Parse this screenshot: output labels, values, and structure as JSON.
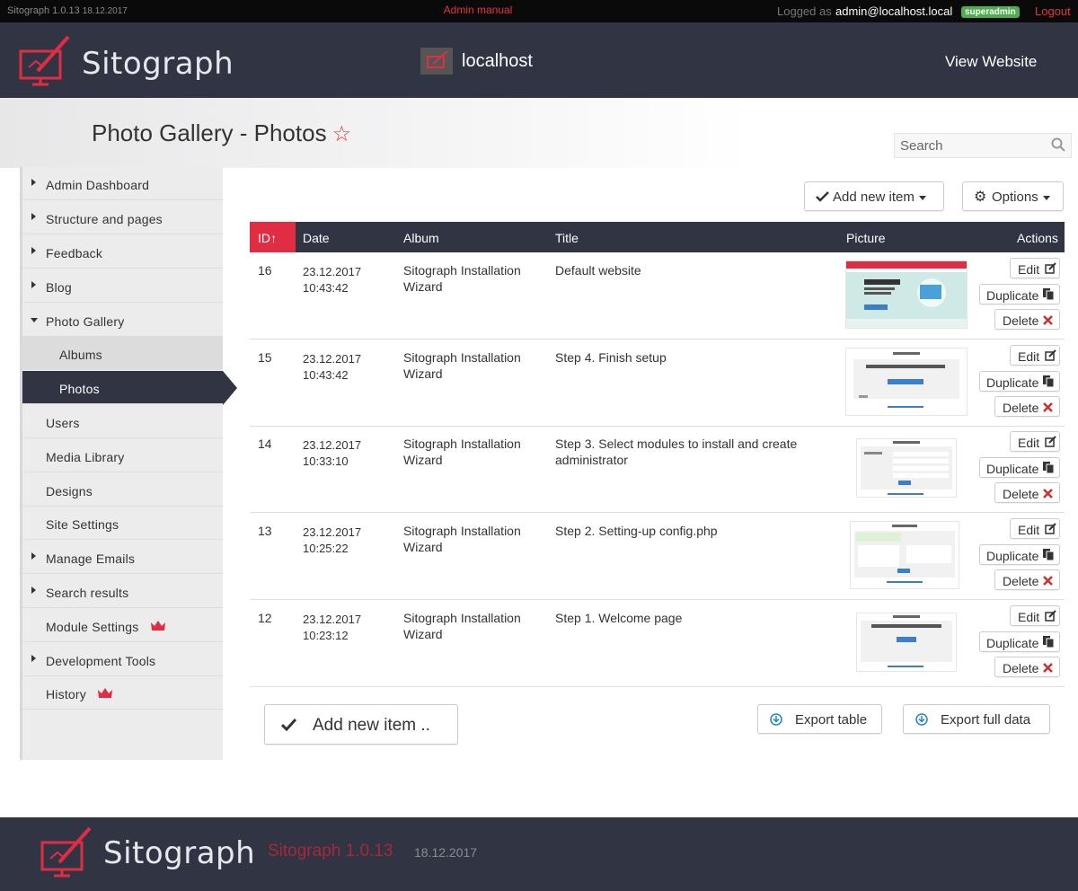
{
  "topbar": {
    "version": "Sitograph 1.0.13",
    "version_date": "18.12.2017",
    "admin_manual": "Admin manual",
    "logged_as": "Logged as",
    "user": "admin@localhost.local",
    "role": "superadmin",
    "logout": "Logout"
  },
  "header": {
    "brand": "Sitograph",
    "site": "localhost",
    "view_website": "View Website"
  },
  "page": {
    "title": "Photo Gallery - Photos",
    "search_placeholder": "Search"
  },
  "sidebar": {
    "items": [
      {
        "label": "Admin Dashboard",
        "arrow": "right"
      },
      {
        "label": "Structure and pages",
        "arrow": "right"
      },
      {
        "label": "Feedback",
        "arrow": "right"
      },
      {
        "label": "Blog",
        "arrow": "right"
      },
      {
        "label": "Photo Gallery",
        "arrow": "down"
      },
      {
        "label": "Albums",
        "sub": true
      },
      {
        "label": "Photos",
        "sub": true,
        "active": true
      },
      {
        "label": "Users"
      },
      {
        "label": "Media Library"
      },
      {
        "label": "Designs"
      },
      {
        "label": "Site Settings"
      },
      {
        "label": "Manage Emails",
        "arrow": "right"
      },
      {
        "label": "Search results",
        "arrow": "right"
      },
      {
        "label": "Module Settings",
        "crown": true
      },
      {
        "label": "Development Tools",
        "arrow": "right"
      },
      {
        "label": "History",
        "crown": true
      }
    ]
  },
  "toolbar": {
    "add_new_item": "Add new item",
    "options": "Options"
  },
  "table": {
    "columns": {
      "id": "ID↑",
      "date": "Date",
      "album": "Album",
      "title": "Title",
      "picture": "Picture",
      "actions": "Actions"
    },
    "rows": [
      {
        "id": "16",
        "date": "23.12.2017",
        "time": "10:43:42",
        "album_l1": "Sitograph Installation",
        "album_l2": "Wizard",
        "title_l1": "Default website",
        "title_l2": ""
      },
      {
        "id": "15",
        "date": "23.12.2017",
        "time": "10:43:42",
        "album_l1": "Sitograph Installation",
        "album_l2": "Wizard",
        "title_l1": "Step 4. Finish setup",
        "title_l2": ""
      },
      {
        "id": "14",
        "date": "23.12.2017",
        "time": "10:33:10",
        "album_l1": "Sitograph Installation",
        "album_l2": "Wizard",
        "title_l1": "Step 3. Select modules to install and create",
        "title_l2": "administrator"
      },
      {
        "id": "13",
        "date": "23.12.2017",
        "time": "10:25:22",
        "album_l1": "Sitograph Installation",
        "album_l2": "Wizard",
        "title_l1": "Step 2. Setting-up config.php",
        "title_l2": ""
      },
      {
        "id": "12",
        "date": "23.12.2017",
        "time": "10:23:12",
        "album_l1": "Sitograph Installation",
        "album_l2": "Wizard",
        "title_l1": "Step 1. Welcome page",
        "title_l2": ""
      }
    ],
    "actions": {
      "edit": "Edit",
      "duplicate": "Duplicate",
      "delete": "Delete"
    }
  },
  "bottom": {
    "add_new_item": "Add new item ..",
    "export_table": "Export table",
    "export_full": "Export full data"
  },
  "footer": {
    "brand": "Sitograph",
    "version": "Sitograph 1.0.13",
    "date": "18.12.2017"
  },
  "colors": {
    "accent": "#e02d44",
    "header_bg": "#313443",
    "badge": "#4cae4c"
  }
}
